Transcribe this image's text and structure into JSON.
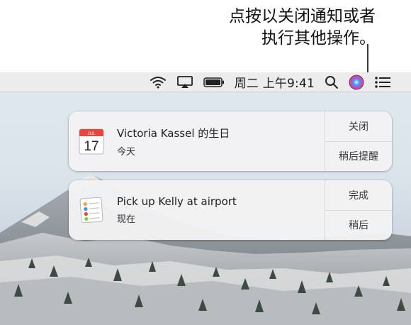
{
  "callout": {
    "line1": "点按以关闭通知或者",
    "line2": "执行其他操作。"
  },
  "menubar": {
    "icons": [
      "wifi-icon",
      "airplay-icon",
      "battery-icon",
      "search-icon",
      "siri-icon",
      "notification-center-icon"
    ],
    "clock": "周二 上午9:41"
  },
  "notifications": [
    {
      "app_icon": "calendar-icon",
      "calendar_date": "17",
      "calendar_month": "JUL",
      "title": "Victoria Kassel 的生日",
      "subtitle": "今天",
      "actions": [
        "关闭",
        "稍后提醒"
      ]
    },
    {
      "app_icon": "reminders-icon",
      "title": "Pick up Kelly at airport",
      "subtitle": "现在",
      "actions": [
        "完成",
        "稍后"
      ]
    }
  ],
  "colors": {
    "menubar_bg": "#ececec",
    "banner_bg": "#f3f3f4",
    "calendar_red": "#e8453c",
    "siri_gradient": [
      "#2bb4ff",
      "#b44bdc",
      "#ff3b6a"
    ]
  }
}
